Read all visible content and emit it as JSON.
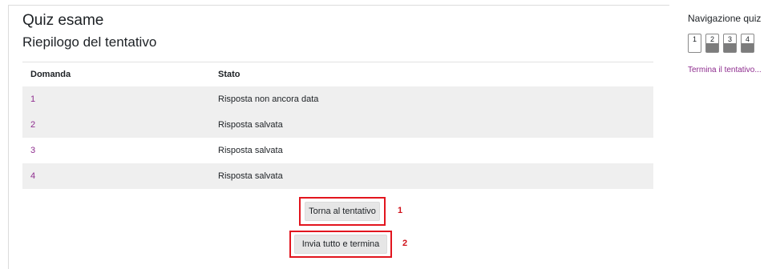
{
  "quiz_title": "Quiz esame",
  "summary_title": "Riepilogo del tentativo",
  "table": {
    "headers": {
      "question": "Domanda",
      "status": "Stato"
    },
    "rows": [
      {
        "question": "1",
        "status": "Risposta non ancora data"
      },
      {
        "question": "2",
        "status": "Risposta salvata"
      },
      {
        "question": "3",
        "status": "Risposta salvata"
      },
      {
        "question": "4",
        "status": "Risposta salvata"
      }
    ]
  },
  "buttons": {
    "return_label": "Torna al tentativo",
    "submit_label": "Invia tutto e termina"
  },
  "annotations": {
    "first": "1",
    "second": "2"
  },
  "navigation": {
    "title": "Navigazione quiz",
    "questions": [
      {
        "label": "1",
        "answered": false
      },
      {
        "label": "2",
        "answered": true
      },
      {
        "label": "3",
        "answered": true
      },
      {
        "label": "4",
        "answered": true
      }
    ],
    "finish_link": "Termina il tentativo..."
  },
  "colors": {
    "link": "#8e2c8e",
    "annotation": "#e2151e",
    "row_shade": "#efefef"
  }
}
